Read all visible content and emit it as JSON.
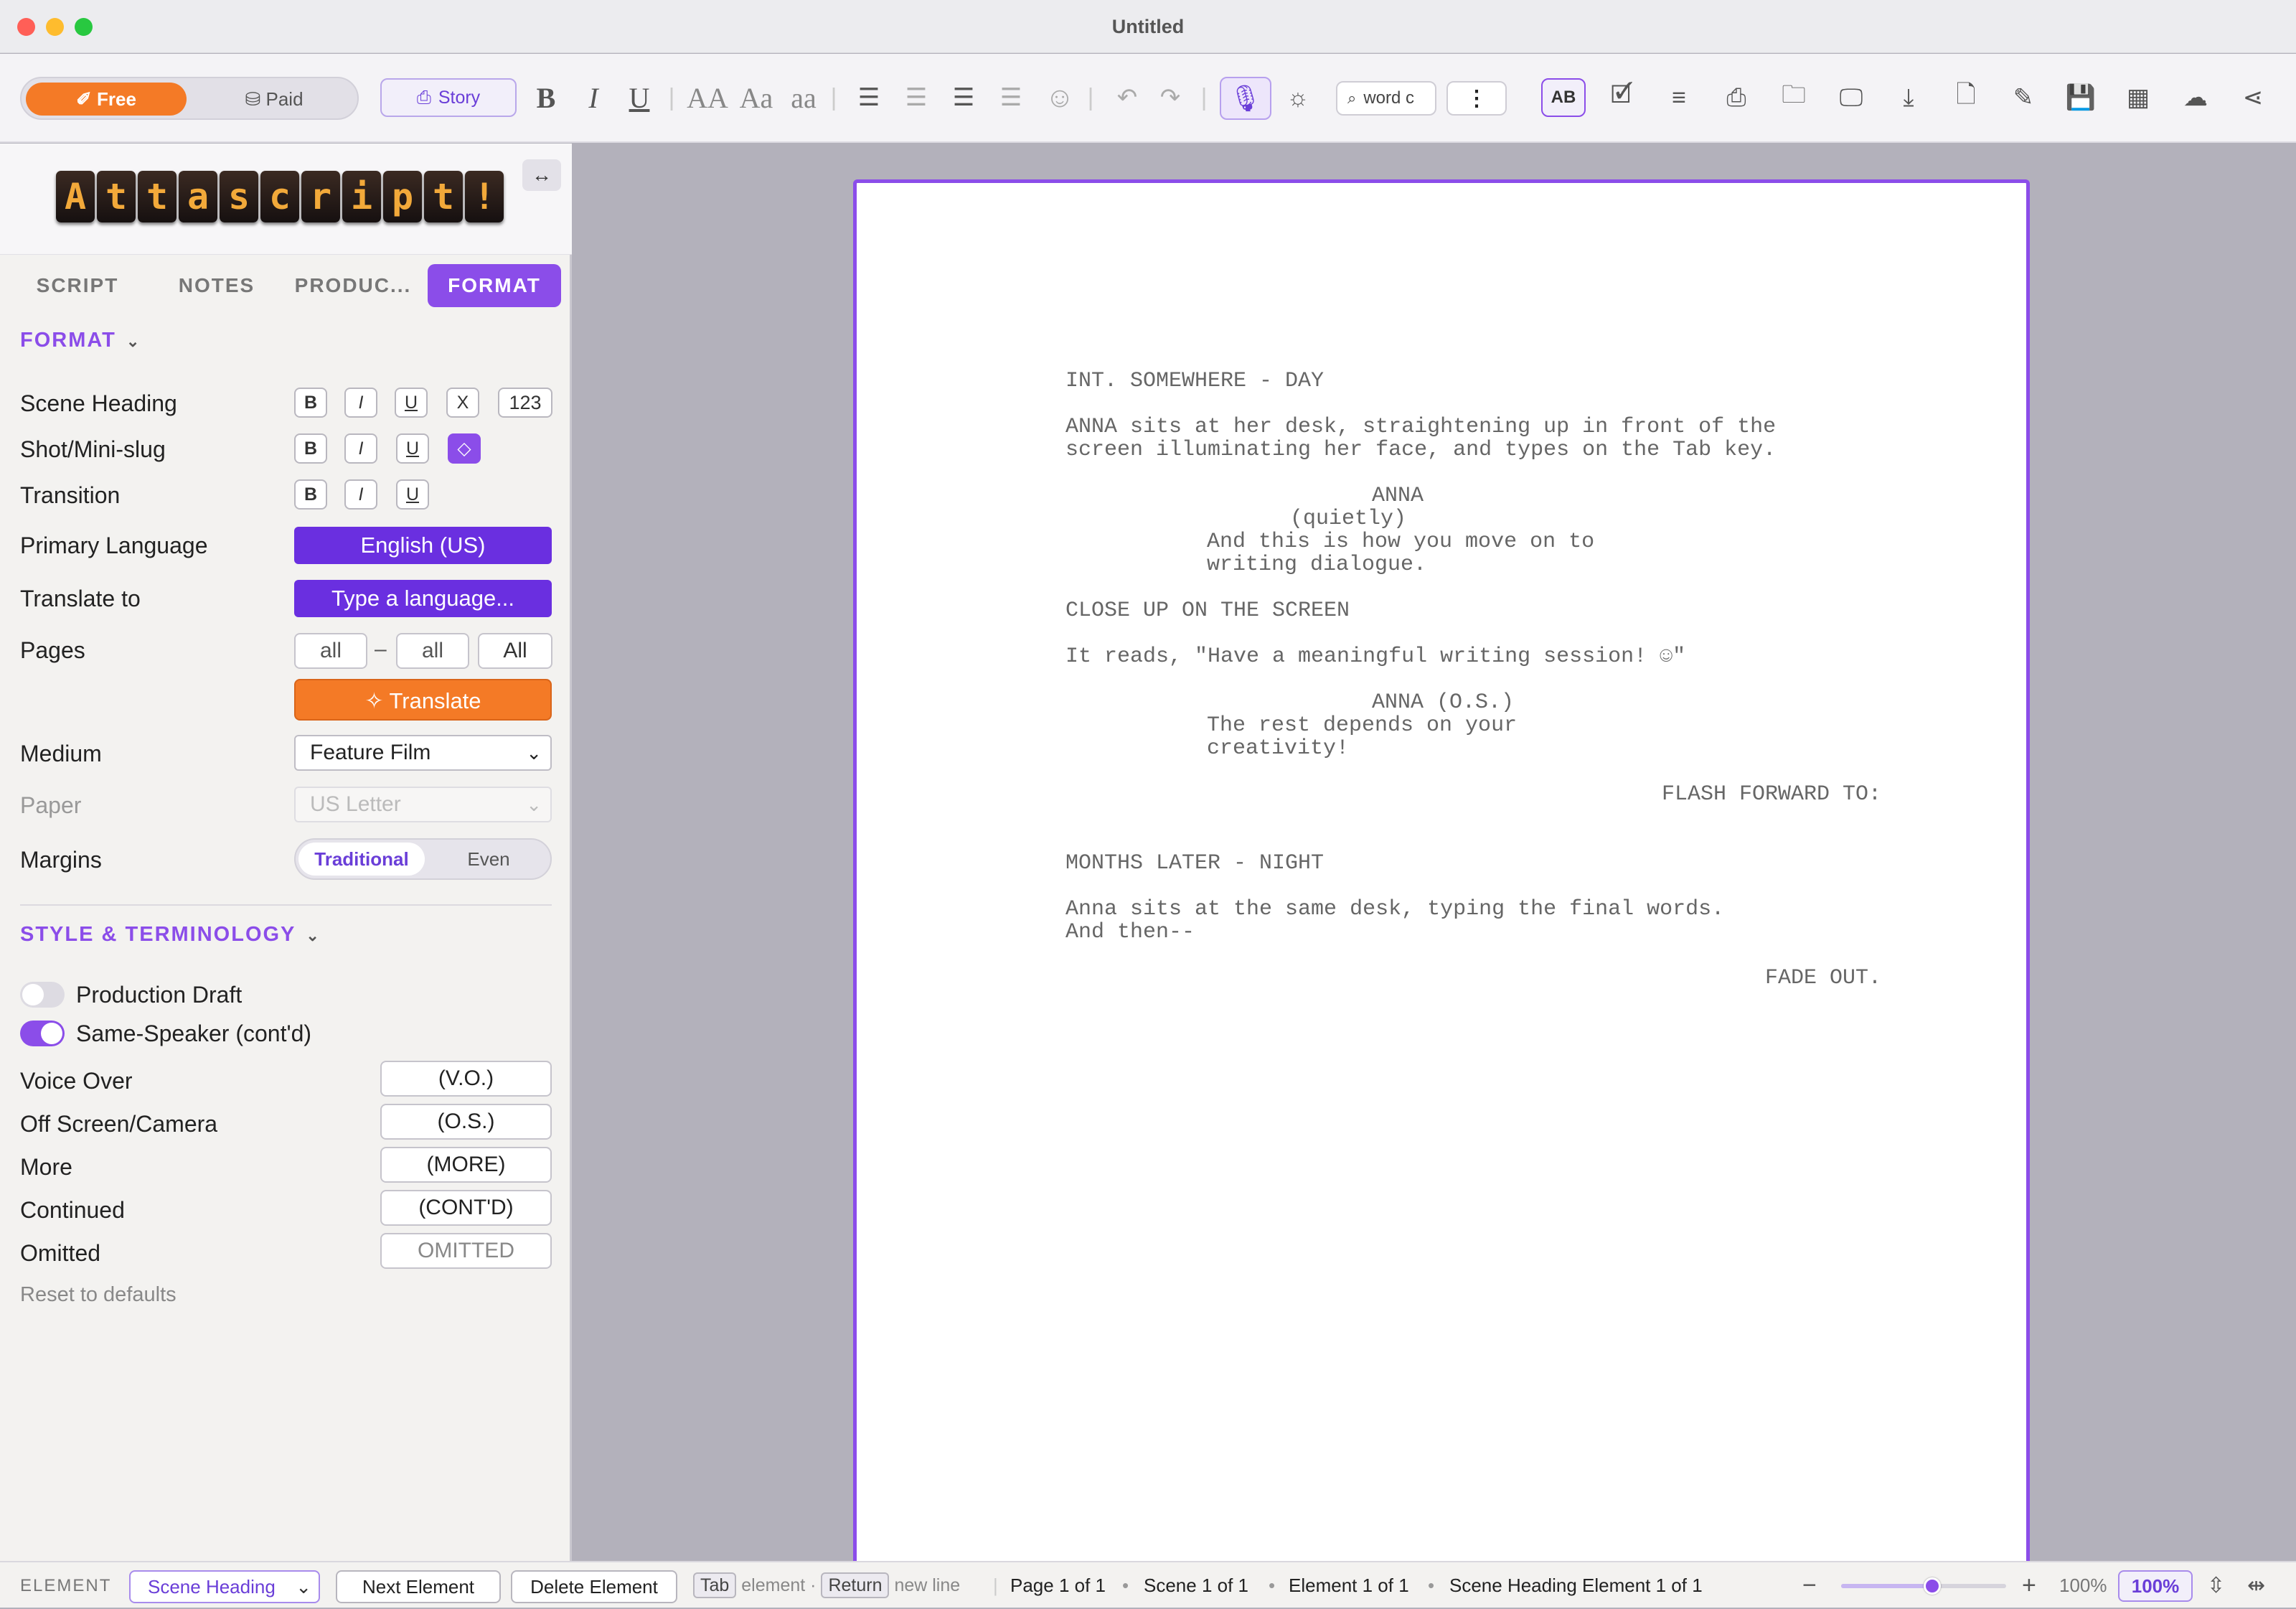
{
  "window": {
    "title": "Untitled"
  },
  "toolbar": {
    "plan_free": "Free",
    "plan_paid": "Paid",
    "story_label": "Story",
    "search_placeholder": "word c",
    "font_sizes": [
      "AA",
      "Aa",
      "aa"
    ]
  },
  "sidebar": {
    "logo_letters": [
      "A",
      "t",
      "t",
      "a",
      "s",
      "c",
      "r",
      "i",
      "p",
      "t",
      "!"
    ],
    "tabs": [
      "SCRIPT",
      "NOTES",
      "PRODUC...",
      "FORMAT"
    ],
    "format": {
      "header": "FORMAT",
      "scene_heading": "Scene Heading",
      "shot": "Shot/Mini-slug",
      "transition": "Transition",
      "bold": "B",
      "italic": "I",
      "underline": "U",
      "x": "X",
      "numbering": "123",
      "primary_language_label": "Primary Language",
      "primary_language": "English (US)",
      "translate_to_label": "Translate to",
      "translate_to_placeholder": "Type a language...",
      "pages_label": "Pages",
      "pages_from": "all",
      "pages_dash": "–",
      "pages_to": "all",
      "pages_all": "All",
      "translate_button": "Translate",
      "medium_label": "Medium",
      "medium_value": "Feature Film",
      "paper_label": "Paper",
      "paper_value": "US Letter",
      "margins_label": "Margins",
      "margins_traditional": "Traditional",
      "margins_even": "Even"
    },
    "style": {
      "header": "STYLE & TERMINOLOGY",
      "production_draft": "Production Draft",
      "production_draft_on": false,
      "same_speaker": "Same-Speaker (cont'd)",
      "same_speaker_on": true,
      "voice_over_label": "Voice Over",
      "voice_over": "(V.O.)",
      "off_screen_label": "Off Screen/Camera",
      "off_screen": "(O.S.)",
      "more_label": "More",
      "more": "(MORE)",
      "continued_label": "Continued",
      "continued": "(CONT'D)",
      "omitted_label": "Omitted",
      "omitted": "OMITTED",
      "reset": "Reset to defaults"
    }
  },
  "script": {
    "l1": "INT. SOMEWHERE - DAY",
    "l2": "ANNA sits at her desk, straightening up in front of the",
    "l3": "screen illuminating her face, and types on the Tab key.",
    "l4": "ANNA",
    "l5": "(quietly)",
    "l6": "And this is how you move on to",
    "l7": "writing dialogue.",
    "l8": "CLOSE UP ON THE SCREEN",
    "l9": "It reads, \"Have a meaningful writing session! ☺\"",
    "l10": "ANNA (O.S.)",
    "l11": "The rest depends on your",
    "l12": "creativity!",
    "l13": "FLASH FORWARD TO:",
    "l14": "MONTHS LATER - NIGHT",
    "l15": "Anna sits at the same desk, typing the final words.",
    "l16": "And then--",
    "l17": "FADE OUT."
  },
  "status": {
    "element_label": "ELEMENT",
    "element_value": "Scene Heading",
    "next_element": "Next Element",
    "delete_element": "Delete Element",
    "tab_key": "Tab",
    "tab_hint": "element ·",
    "return_key": "Return",
    "return_hint": "new line",
    "page_info": "Page 1 of 1",
    "scene_info": "Scene 1 of 1",
    "element_info": "Element 1 of 1",
    "scene_heading_info": "Scene Heading Element 1 of 1",
    "zoom_percent": "100%",
    "zoom_field": "100%",
    "zoom_level": 0.55
  }
}
